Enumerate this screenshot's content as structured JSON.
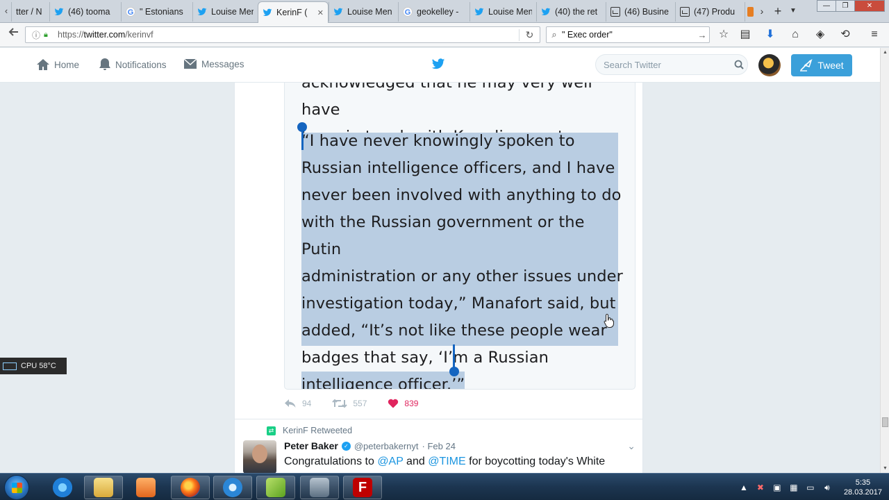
{
  "browser": {
    "tabs": [
      {
        "label": "tter / N",
        "icon": "none"
      },
      {
        "label": "(46) tooma",
        "icon": "twitter"
      },
      {
        "label": "\" Estonians",
        "icon": "google"
      },
      {
        "label": "Louise Men",
        "icon": "twitter"
      },
      {
        "label": "KerinF (",
        "icon": "twitter",
        "active": true
      },
      {
        "label": "Louise Men",
        "icon": "twitter"
      },
      {
        "label": "geokelley -",
        "icon": "google"
      },
      {
        "label": "Louise Men",
        "icon": "twitter"
      },
      {
        "label": "(40) the ret",
        "icon": "twitter"
      },
      {
        "label": "(46) Busine",
        "icon": "doc"
      },
      {
        "label": "(47) Produ",
        "icon": "doc"
      }
    ],
    "url_host": "twitter.com",
    "url_path": "/kerinvf",
    "url_scheme": "https://",
    "search_text": "\" Exec order\""
  },
  "twitter": {
    "nav": {
      "home": "Home",
      "notifications": "Notifications",
      "messages": "Messages"
    },
    "search_placeholder": "Search Twitter",
    "tweet_button": "Tweet"
  },
  "article": {
    "lines_top": [
      "acknowledged that he may very well have",
      "been in touch with Kremlin agents."
    ],
    "selected_lines": [
      "“I have never knowingly spoken to",
      "Russian intelligence officers, and I have",
      "never been involved with anything to do",
      "with the Russian government or the Putin",
      "administration or any other issues under",
      "investigation today,” Manafort said, but",
      "added, “It’s not like these people wear",
      "badges that say, ‘I’m a Russian",
      "intelligence officer.’”"
    ]
  },
  "tweet_actions": {
    "replies": "94",
    "retweets": "557",
    "likes": "839"
  },
  "next_tweet": {
    "retweeted_by": "KerinF Retweeted",
    "name": "Peter Baker",
    "handle": "@peterbakernyt",
    "date": "Feb 24",
    "text_pre": "Congratulations to ",
    "mention1": "@AP",
    "text_mid": " and ",
    "mention2": "@TIME",
    "text_post": " for boycotting today's White"
  },
  "cpu_widget": {
    "label": "CPU 58°C"
  },
  "taskbar": {
    "time": "5:35",
    "date": "28.03.2017"
  },
  "colors": {
    "twitter_blue": "#1da1f2",
    "tweet_button": "#3ba0da",
    "selection": "#b9cde2",
    "caret": "#1565c0",
    "like_red": "#e0245e"
  }
}
